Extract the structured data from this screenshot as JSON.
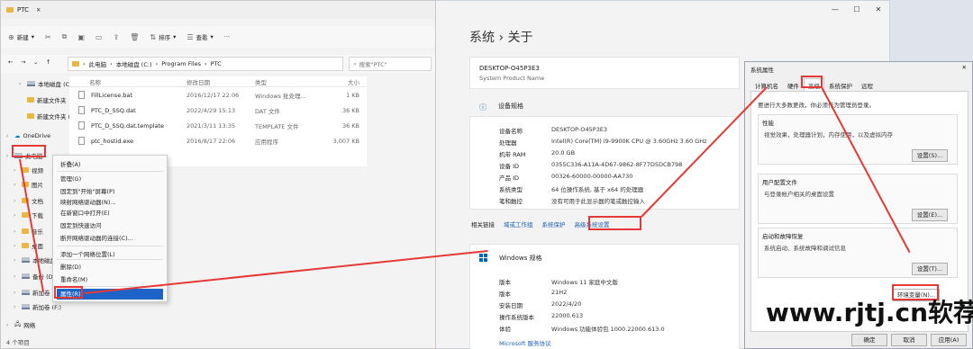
{
  "explorer": {
    "title": "PTC",
    "toolbar": {
      "new": "新建",
      "sort": "排序",
      "view": "查看",
      "more": "···"
    },
    "breadcrumb": [
      "此电脑",
      "本地磁盘 (C:)",
      "Program Files",
      "PTC"
    ],
    "search_placeholder": "搜索\"PTC\"",
    "columns": [
      "名称",
      "修改日期",
      "类型",
      "大小"
    ],
    "files": [
      {
        "name": "FillLicense.bat",
        "date": "2016/12/17 22:06",
        "type": "Windows 批处理...",
        "size": "1 KB"
      },
      {
        "name": "PTC_D_SSQ.dat",
        "date": "2022/4/29 15:13",
        "type": "DAT 文件",
        "size": "36 KB"
      },
      {
        "name": "PTC_D_SSQ.dat.template",
        "date": "2021/3/11 13:35",
        "type": "TEMPLATE 文件",
        "size": "36 KB"
      },
      {
        "name": "ptc_hostid.exe",
        "date": "2016/8/17 22:06",
        "type": "应用程序",
        "size": "3,007 KB"
      }
    ],
    "sidebar": [
      {
        "label": "本地磁盘 (C:)",
        "kind": "drive"
      },
      {
        "label": "新建文件夹",
        "kind": "folder"
      },
      {
        "label": "新建文件夹 (2)",
        "kind": "folder"
      },
      {
        "label": "OneDrive",
        "kind": "cloud"
      },
      {
        "label": "此电脑",
        "kind": "pc"
      },
      {
        "label": "视频",
        "kind": "folder"
      },
      {
        "label": "图片",
        "kind": "folder"
      },
      {
        "label": "文档",
        "kind": "folder"
      },
      {
        "label": "下载",
        "kind": "folder"
      },
      {
        "label": "音乐",
        "kind": "folder"
      },
      {
        "label": "桌面",
        "kind": "folder"
      },
      {
        "label": "本地磁盘",
        "kind": "drive"
      },
      {
        "label": "备份 (D:)",
        "kind": "drive"
      },
      {
        "label": "新加卷 (E:)",
        "kind": "drive"
      },
      {
        "label": "新加卷 (F:)",
        "kind": "drive"
      },
      {
        "label": "网络",
        "kind": "net"
      }
    ],
    "status": "4 个项目"
  },
  "context_menu": [
    "折叠(A)",
    "管理(G)",
    "固定到\"开始\"屏幕(P)",
    "映射网络驱动器(N)...",
    "在新窗口中打开(E)",
    "固定到快速访问",
    "断开网络驱动器的连接(C)...",
    "添加一个网络位置(L)",
    "删除(D)",
    "重命名(M)",
    "属性(R)"
  ],
  "settings": {
    "breadcrumb": "系统  ›  关于",
    "device_name": "DESKTOP-O45P3E3",
    "device_model": "System Product Name",
    "spec_title": "设备规格",
    "specs": [
      {
        "k": "设备名称",
        "v": "DESKTOP-O45P3E3"
      },
      {
        "k": "处理器",
        "v": "Intel(R) Core(TM) i9-9900K CPU @ 3.60GHz   3.60 GHz"
      },
      {
        "k": "机带 RAM",
        "v": "20.0 GB"
      },
      {
        "k": "设备 ID",
        "v": "0355C336-A11A-4D67-9862-8F77D5DCB798"
      },
      {
        "k": "产品 ID",
        "v": "00326-60000-00000-AA730"
      },
      {
        "k": "系统类型",
        "v": "64 位操作系统, 基于 x64 的处理器"
      },
      {
        "k": "笔和触控",
        "v": "没有可用于此显示器的笔或触控输入"
      }
    ],
    "related_label": "相关链接",
    "links": [
      "域或工作组",
      "系统保护",
      "高级系统设置"
    ],
    "win_title": "Windows 规格",
    "win_specs": [
      {
        "k": "版本",
        "v": "Windows 11 家庭中文版"
      },
      {
        "k": "版本",
        "v": "21H2"
      },
      {
        "k": "安装日期",
        "v": "2022/4/20"
      },
      {
        "k": "操作系统版本",
        "v": "22000.613"
      },
      {
        "k": "体验",
        "v": "Windows 功能体验包 1000.22000.613.0"
      }
    ],
    "ms_link": "Microsoft 服务协议"
  },
  "sysprop": {
    "title": "系统属性",
    "tabs": [
      "计算机名",
      "硬件",
      "高级",
      "系统保护",
      "远程"
    ],
    "note": "要进行大多数更改，你必须作为管理员登录。",
    "groups": [
      {
        "title": "性能",
        "desc": "视觉效果，处理器计划，内存使用，以及虚拟内存",
        "button": "设置(S)..."
      },
      {
        "title": "用户配置文件",
        "desc": "与登录帐户相关的桌面设置",
        "button": "设置(E)..."
      },
      {
        "title": "启动和故障恢复",
        "desc": "系统启动、系统故障和调试信息",
        "button": "设置(T)..."
      }
    ],
    "env_button": "环境变量(N)...",
    "ok": "确定",
    "cancel": "取消",
    "apply": "应用(A)"
  },
  "watermark": "www.rjtj.cn软荐网",
  "colors": {
    "annotation": "#e53935",
    "accent": "#1a5fb4",
    "selection": "#1e64c8"
  }
}
